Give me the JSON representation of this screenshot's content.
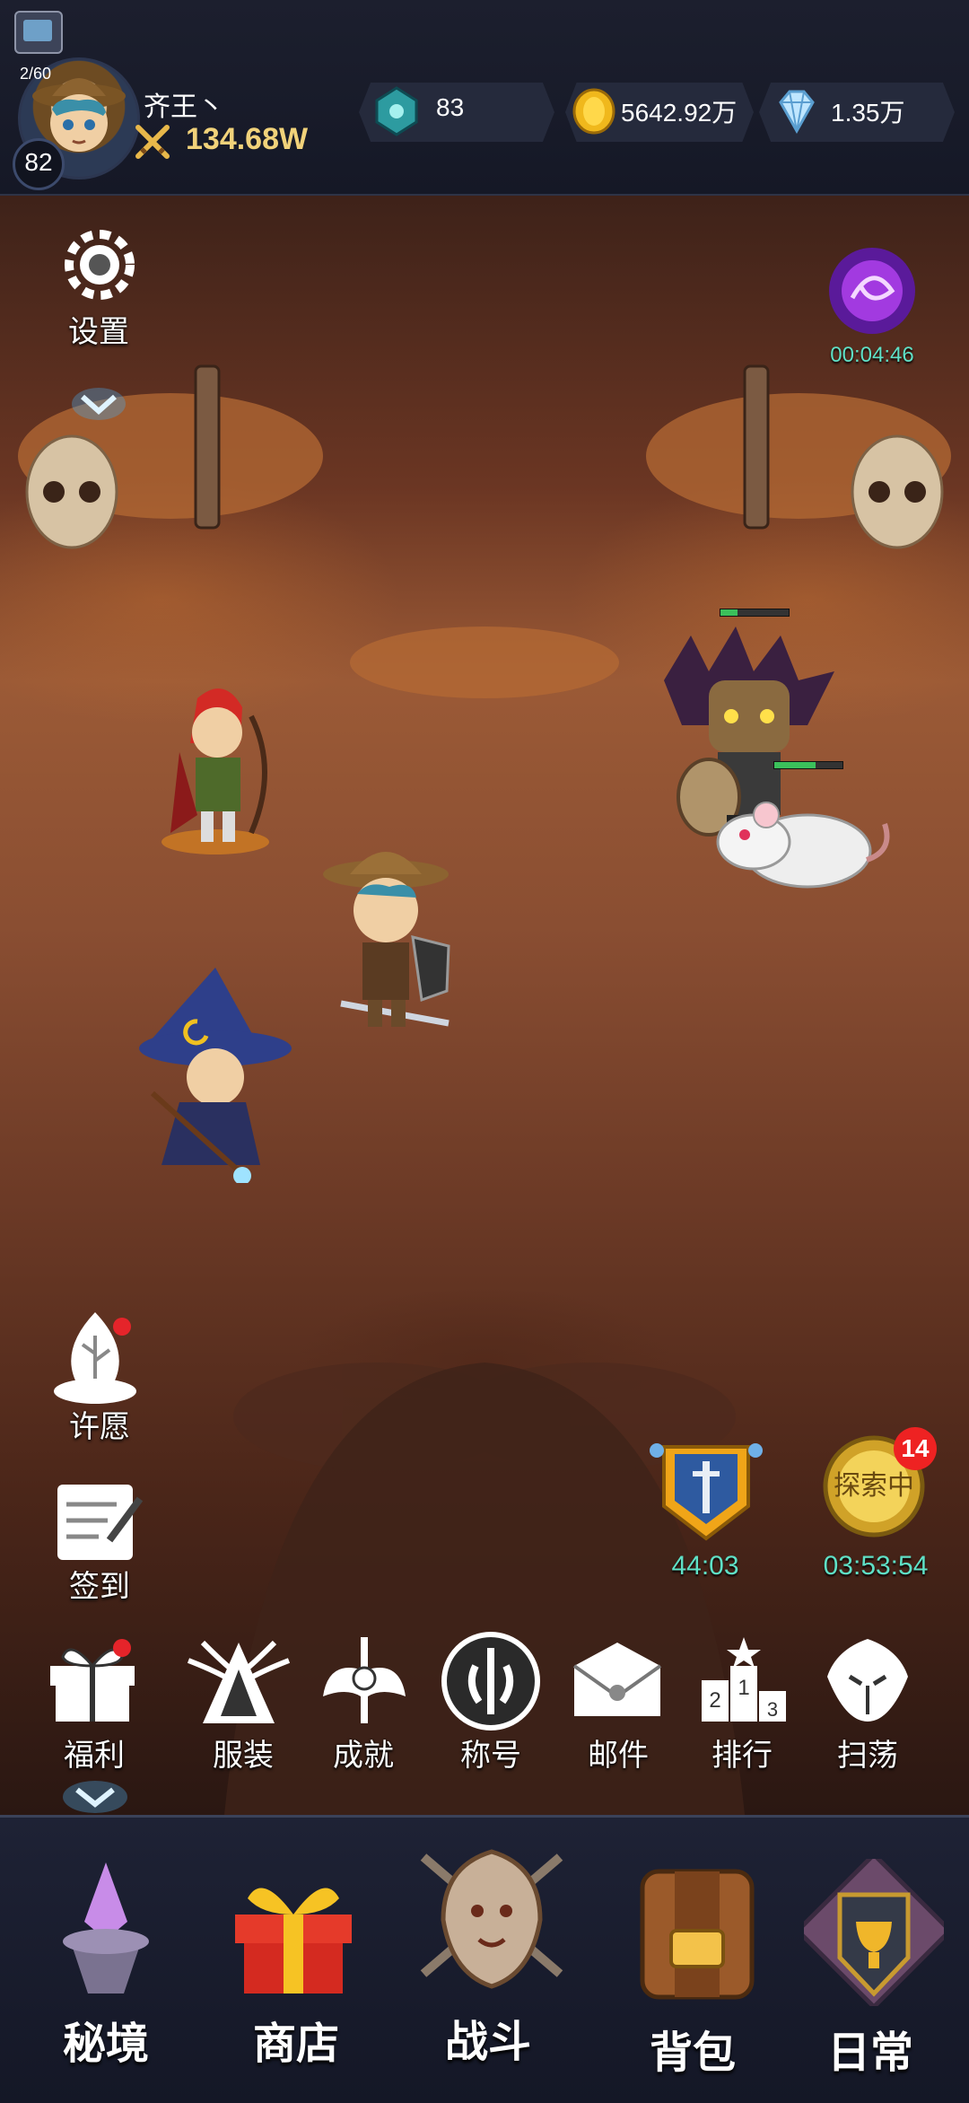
{
  "player": {
    "stamina": "2/60",
    "level": "82",
    "name": "齐王丶",
    "power": "134.68W"
  },
  "resources": [
    {
      "name": "gem-icon",
      "value": "83"
    },
    {
      "name": "gold-coin-icon",
      "value": "5642.92万"
    },
    {
      "name": "diamond-icon",
      "value": "1.35万"
    }
  ],
  "left_menu": {
    "settings": "设置",
    "wish": "许愿",
    "signin": "签到"
  },
  "portal_timer": "00:04:46",
  "quests": {
    "battle_timer": "44:03",
    "explore_label": "探索中",
    "explore_badge": "14",
    "explore_timer": "03:53:54"
  },
  "func_row": [
    {
      "label": "福利",
      "icon": "gift-icon"
    },
    {
      "label": "服装",
      "icon": "antler-icon"
    },
    {
      "label": "成就",
      "icon": "wing-sword-icon"
    },
    {
      "label": "称号",
      "icon": "title-emblem-icon"
    },
    {
      "label": "邮件",
      "icon": "mail-icon"
    },
    {
      "label": "排行",
      "icon": "podium-icon"
    },
    {
      "label": "扫荡",
      "icon": "dragon-icon"
    }
  ],
  "bottom_nav": [
    {
      "label": "秘境",
      "icon": "crystal-island-icon"
    },
    {
      "label": "商店",
      "icon": "gift-box-icon"
    },
    {
      "label": "战斗",
      "icon": "lion-crest-icon"
    },
    {
      "label": "背包",
      "icon": "backpack-icon"
    },
    {
      "label": "日常",
      "icon": "chalice-shield-icon"
    }
  ],
  "colors": {
    "accent_timer": "#5fe0c6",
    "power_gold": "#f1d27a",
    "badge_red": "#e22222"
  }
}
